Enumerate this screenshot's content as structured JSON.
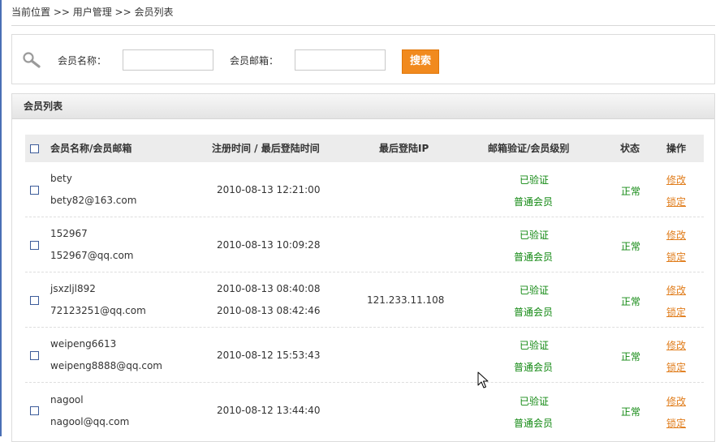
{
  "breadcrumb": "当前位置 >> 用户管理 >> 会员列表",
  "search": {
    "name_label": "会员名称：",
    "email_label": "会员邮箱：",
    "name_value": "",
    "email_value": "",
    "button_label": "搜索"
  },
  "panel": {
    "title": "会员列表"
  },
  "table": {
    "headers": {
      "name_email": "会员名称/会员邮箱",
      "times": "注册时间 / 最后登陆时间",
      "ip": "最后登陆IP",
      "verify_level": "邮箱验证/会员级别",
      "status": "状态",
      "action": "操作"
    },
    "rows": [
      {
        "name": "bety",
        "email": "bety82@163.com",
        "reg_time": "2010-08-13 12:21:00",
        "last_time": "",
        "ip": "",
        "verify": "已验证",
        "level": "普通会员",
        "status": "正常",
        "edit": "修改",
        "lock": "锁定"
      },
      {
        "name": "152967",
        "email": "152967@qq.com",
        "reg_time": "2010-08-13 10:09:28",
        "last_time": "",
        "ip": "",
        "verify": "已验证",
        "level": "普通会员",
        "status": "正常",
        "edit": "修改",
        "lock": "锁定"
      },
      {
        "name": "jsxzljl892",
        "email": "72123251@qq.com",
        "reg_time": "2010-08-13 08:40:08",
        "last_time": "2010-08-13 08:42:46",
        "ip": "121.233.11.108",
        "verify": "已验证",
        "level": "普通会员",
        "status": "正常",
        "edit": "修改",
        "lock": "锁定"
      },
      {
        "name": "weipeng6613",
        "email": "weipeng8888@qq.com",
        "reg_time": "2010-08-12 15:53:43",
        "last_time": "",
        "ip": "",
        "verify": "已验证",
        "level": "普通会员",
        "status": "正常",
        "edit": "修改",
        "lock": "锁定"
      },
      {
        "name": "nagool",
        "email": "nagool@qq.com",
        "reg_time": "2010-08-12 13:44:40",
        "last_time": "",
        "ip": "",
        "verify": "已验证",
        "level": "普通会员",
        "status": "正常",
        "edit": "修改",
        "lock": "锁定"
      }
    ]
  },
  "colors": {
    "accent_button": "#f18a1e",
    "link": "#e07c1a",
    "status_green": "#118811"
  },
  "icons": {
    "search": "magnifier-icon",
    "cursor": "mouse-pointer-icon"
  }
}
